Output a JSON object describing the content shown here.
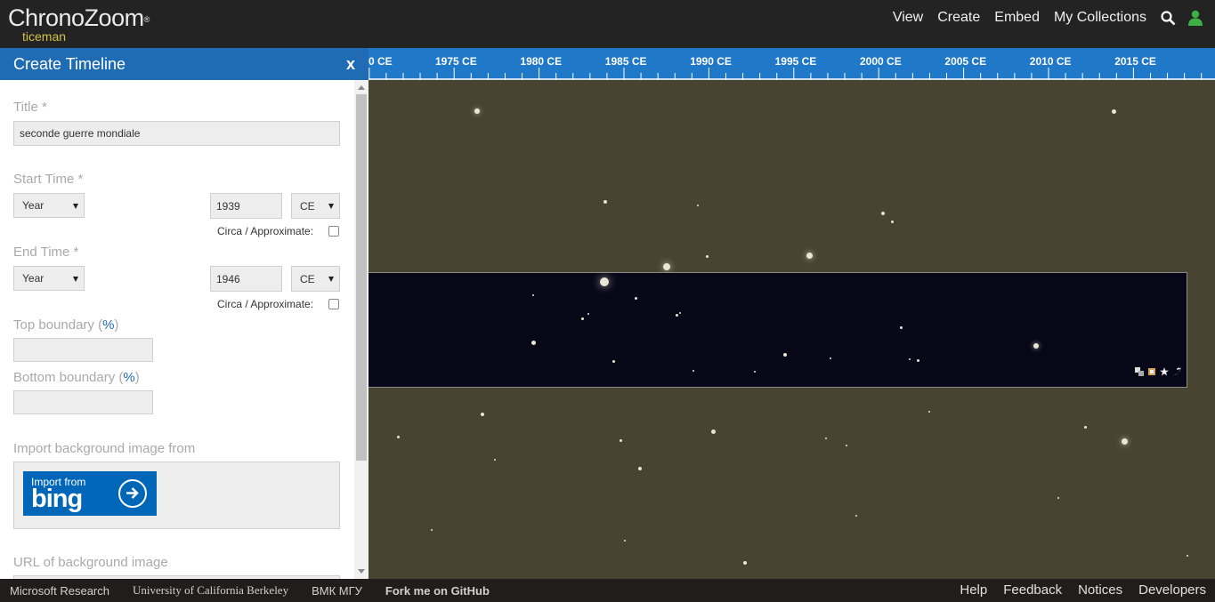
{
  "header": {
    "logo": "ChronoZoom",
    "logo_mark": "®",
    "username": "ticeman",
    "nav": {
      "view": "View",
      "create": "Create",
      "embed": "Embed",
      "my_collections": "My Collections"
    }
  },
  "panel": {
    "title": "Create Timeline",
    "close": "x",
    "title_label": "Title *",
    "title_value": "seconde guerre mondiale",
    "start_label": "Start Time *",
    "start_mode": "Year",
    "start_year": "1939",
    "start_era": "CE",
    "circa": "Circa / Approximate:",
    "end_label": "End Time *",
    "end_mode": "Year",
    "end_year": "1946",
    "end_era": "CE",
    "top_boundary_label": "Top boundary (",
    "bottom_boundary_label": "Bottom boundary (",
    "pct": "%",
    "close_paren": ")",
    "import_label": "Import background image from",
    "bing_small": "Import from",
    "bing_big": "bing",
    "url_label": "URL of background image"
  },
  "ruler": {
    "labels": [
      "0 CE",
      "1975 CE",
      "1980 CE",
      "1985 CE",
      "1990 CE",
      "1995 CE",
      "2000 CE",
      "2005 CE",
      "2010 CE",
      "2015 CE"
    ]
  },
  "footer": {
    "left": [
      "Microsoft Research",
      "University of California Berkeley",
      "ВМК МГУ",
      "Fork me on GitHub"
    ],
    "right": [
      "Help",
      "Feedback",
      "Notices",
      "Developers"
    ]
  },
  "colors": {
    "header_bg": "#232323",
    "accent_blue": "#1f6cb4",
    "ruler_blue": "#1f78c8",
    "canvas_bg": "#494332",
    "band_bg": "#080718",
    "username": "#d4c24a"
  }
}
